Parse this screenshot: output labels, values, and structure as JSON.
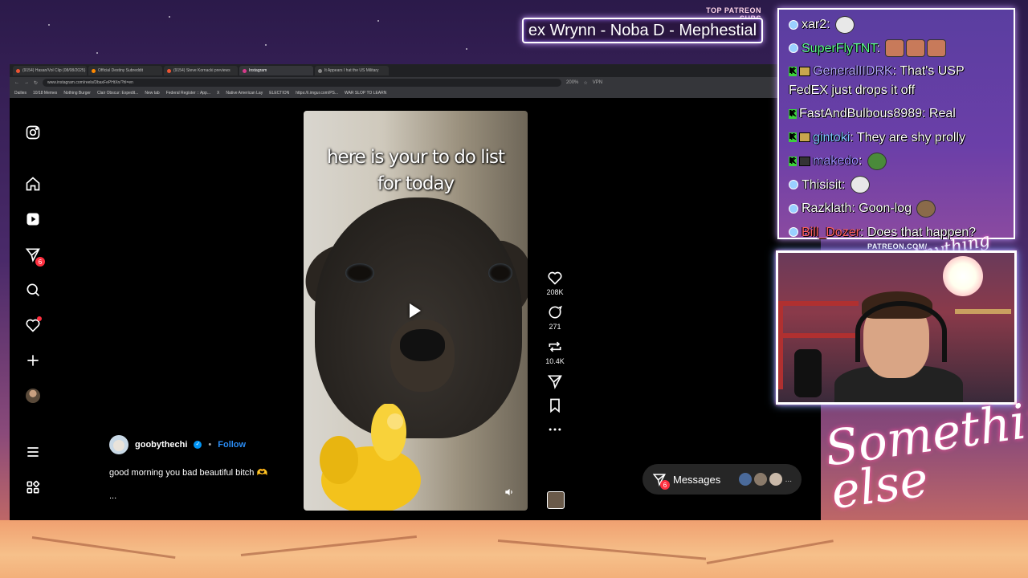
{
  "overlay": {
    "top_patreon_label": "TOP PATREON SUBS",
    "top_patreon_subs": "ex Wrynn -  Noba D - Mephestial",
    "patreon_url": "PATREON.COM/",
    "brand_script": "Anything else?",
    "big_script": "Something else"
  },
  "browser": {
    "tabs": [
      {
        "label": "(9154) Hasan/Vol Clip (08/08/2025)",
        "active": false
      },
      {
        "label": "Official Destiny Subreddit",
        "active": false
      },
      {
        "label": "(9154) Steve Kornacki previews",
        "active": false
      },
      {
        "label": "Instagram",
        "active": true
      },
      {
        "label": "It Appears I hat the US Military",
        "active": false
      }
    ],
    "url": "www.instagram.com/reels/DbaxFePHtXn/?hl=en",
    "zoom": "200%",
    "vpn_label": "VPN",
    "bookmarks": [
      "Dailies",
      "10/18 Memes",
      "Nothing Burger",
      "Clair Obscur: Expedit...",
      "New tab",
      "Federal Register :: App...",
      "X",
      "Native American Lay",
      "ELECTION",
      "https://i.imgur.com/PS...",
      "WAR SLOP TO LEARN"
    ]
  },
  "instagram": {
    "nav": {
      "notifications_badge": "6"
    },
    "reel": {
      "caption_line1": "here is your to do list",
      "caption_line2": "for today"
    },
    "actions": {
      "likes": "208K",
      "comments": "271",
      "reposts": "10.4K"
    },
    "author": {
      "username": "goobythechi",
      "separator": "•",
      "follow_label": "Follow",
      "caption": "good morning you bad beautiful bitch 🫶",
      "more": "..."
    },
    "messages": {
      "label": "Messages",
      "badge": "6",
      "more": "..."
    }
  },
  "chat": {
    "messages": [
      {
        "user": "xar2",
        "text": "",
        "user_color": "#ffffff"
      },
      {
        "user": "SuperFlyTNT",
        "text": "",
        "user_color": "#5dfc8f"
      },
      {
        "user": "GeneralIIDRK",
        "text": "That's USP FedEX just drops it off",
        "user_color": "#b3a5ff"
      },
      {
        "user": "FastAndBulbous8989",
        "text": "Real",
        "user_color": "#ffffff"
      },
      {
        "user": "gintoki",
        "text": "They are shy prolly",
        "user_color": "#7cc7ff"
      },
      {
        "user": "makedo",
        "text": "",
        "user_color": "#9b8cff"
      },
      {
        "user": "Thisisit",
        "text": "",
        "user_color": "#ffffff"
      },
      {
        "user": "Razklath",
        "text": "Goon-log",
        "user_color": "#ffffff"
      },
      {
        "user": "Bill_Dozer",
        "text": "Does that happen?",
        "user_color": "#ff6060"
      }
    ]
  },
  "colors": {
    "ig_link": "#2a8bf2",
    "badge_red": "#ff3040",
    "chat_bg": "#6b3fa8"
  }
}
